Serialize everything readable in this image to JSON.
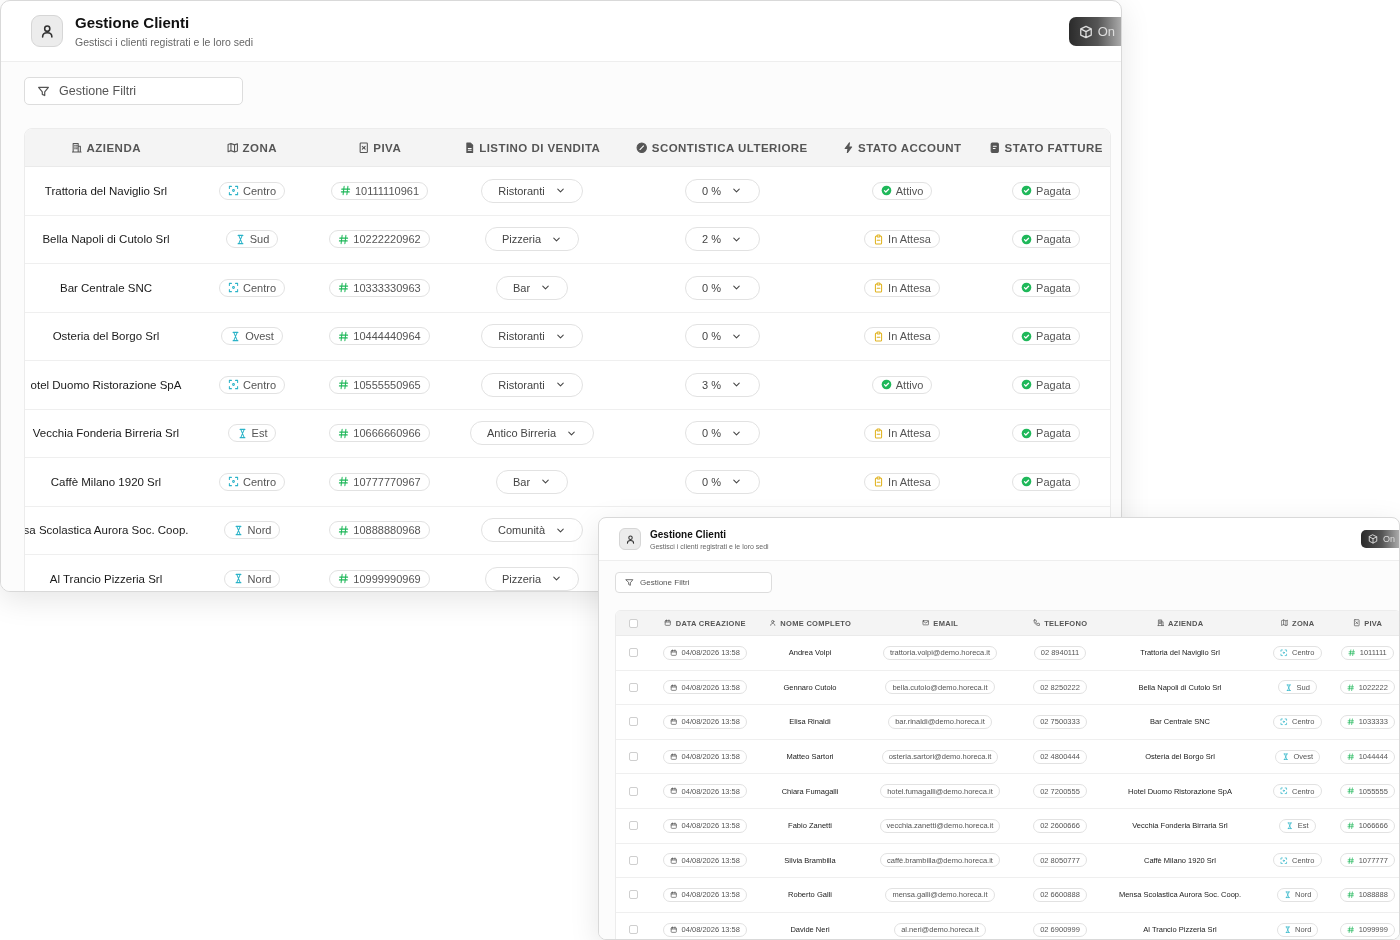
{
  "windows": [
    {
      "title": "Gestione Clienti",
      "subtitle": "Gestisci i clienti registrati e le loro sedi",
      "action_button": "On",
      "filter_button": "Gestione Filtri",
      "table": {
        "columns": [
          {
            "label": "AZIENDA",
            "kind": "company"
          },
          {
            "label": "ZONA",
            "kind": "zone"
          },
          {
            "label": "PIVA",
            "kind": "vat"
          },
          {
            "label": "LISTINO DI VENDITA",
            "kind": "price_list"
          },
          {
            "label": "SCONTISTICA ULTERIORE",
            "kind": "discount"
          },
          {
            "label": "STATO ACCOUNT",
            "kind": "account"
          },
          {
            "label": "STATO FATTURE",
            "kind": "invoice"
          }
        ],
        "rows": [
          {
            "cells": [
              "Trattoria del Naviglio Srl",
              {
                "label": "Centro",
                "kind": "center"
              },
              "10111110961",
              "Ristoranti",
              "0 %",
              {
                "label": "Attivo",
                "kind": "active"
              },
              {
                "label": "Pagata",
                "kind": "paid"
              }
            ]
          },
          {
            "cells": [
              "Bella Napoli di Cutolo Srl",
              {
                "label": "Sud",
                "kind": "direction"
              },
              "10222220962",
              "Pizzeria",
              "2 %",
              {
                "label": "In Attesa",
                "kind": "pending"
              },
              {
                "label": "Pagata",
                "kind": "paid"
              }
            ]
          },
          {
            "cells": [
              "Bar Centrale SNC",
              {
                "label": "Centro",
                "kind": "center"
              },
              "10333330963",
              "Bar",
              "0 %",
              {
                "label": "In Attesa",
                "kind": "pending"
              },
              {
                "label": "Pagata",
                "kind": "paid"
              }
            ]
          },
          {
            "cells": [
              "Osteria del Borgo Srl",
              {
                "label": "Ovest",
                "kind": "direction"
              },
              "10444440964",
              "Ristoranti",
              "0 %",
              {
                "label": "In Attesa",
                "kind": "pending"
              },
              {
                "label": "Pagata",
                "kind": "paid"
              }
            ]
          },
          {
            "cells": [
              "otel Duomo Ristorazione SpA",
              {
                "label": "Centro",
                "kind": "center"
              },
              "10555550965",
              "Ristoranti",
              "3 %",
              {
                "label": "Attivo",
                "kind": "active"
              },
              {
                "label": "Pagata",
                "kind": "paid"
              }
            ]
          },
          {
            "cells": [
              "Vecchia Fonderia Birreria Srl",
              {
                "label": "Est",
                "kind": "direction"
              },
              "10666660966",
              "Antico Birreria",
              "0 %",
              {
                "label": "In Attesa",
                "kind": "pending"
              },
              {
                "label": "Pagata",
                "kind": "paid"
              }
            ]
          },
          {
            "cells": [
              "Caffè Milano 1920 Srl",
              {
                "label": "Centro",
                "kind": "center"
              },
              "10777770967",
              "Bar",
              "0 %",
              {
                "label": "In Attesa",
                "kind": "pending"
              },
              {
                "label": "Pagata",
                "kind": "paid"
              }
            ]
          },
          {
            "cells": [
              "sa Scolastica Aurora Soc. Coop.",
              {
                "label": "Nord",
                "kind": "direction"
              },
              "10888880968",
              "Comunità",
              null,
              null,
              null
            ]
          },
          {
            "cells": [
              "Al Trancio Pizzeria Srl",
              {
                "label": "Nord",
                "kind": "direction"
              },
              "10999990969",
              "Pizzeria",
              null,
              null,
              null
            ]
          }
        ]
      }
    },
    {
      "title": "Gestione Clienti",
      "subtitle": "Gestisci i clienti registrati e le loro sedi",
      "action_button": "On",
      "filter_button": "Gestione Filtri",
      "table": {
        "header_checkbox": {
          "checked": false
        },
        "columns": [
          {
            "label": "DATA CREAZIONE",
            "kind": "date"
          },
          {
            "label": "NOME COMPLETO",
            "kind": "name"
          },
          {
            "label": "EMAIL",
            "kind": "email"
          },
          {
            "label": "TELEFONO",
            "kind": "phone"
          },
          {
            "label": "AZIENDA",
            "kind": "company"
          },
          {
            "label": "ZONA",
            "kind": "zone"
          },
          {
            "label": "PIVA",
            "kind": "vat"
          }
        ],
        "rows": [
          {
            "checked": false,
            "cells": [
              "04/08/2026 13:58",
              "Andrea Volpi",
              "trattoria.volpi@demo.horeca.it",
              "02 8940111",
              "Trattoria del Naviglio Srl",
              {
                "label": "Centro",
                "kind": "center"
              },
              "1011111"
            ]
          },
          {
            "checked": false,
            "cells": [
              "04/08/2026 13:58",
              "Gennaro Cutolo",
              "bella.cutolo@demo.horeca.it",
              "02 8250222",
              "Bella Napoli di Cutolo Srl",
              {
                "label": "Sud",
                "kind": "direction"
              },
              "1022222"
            ]
          },
          {
            "checked": false,
            "cells": [
              "04/08/2026 13:58",
              "Elisa Rinaldi",
              "bar.rinaldi@demo.horeca.it",
              "02 7500333",
              "Bar Centrale SNC",
              {
                "label": "Centro",
                "kind": "center"
              },
              "1033333"
            ]
          },
          {
            "checked": false,
            "cells": [
              "04/08/2026 13:58",
              "Matteo Sartori",
              "osteria.sartori@demo.horeca.it",
              "02 4800444",
              "Osteria del Borgo Srl",
              {
                "label": "Ovest",
                "kind": "direction"
              },
              "1044444"
            ]
          },
          {
            "checked": false,
            "cells": [
              "04/08/2026 13:58",
              "Chiara Fumagalli",
              "hotel.fumagalli@demo.horeca.it",
              "02 7200555",
              "Hotel Duomo Ristorazione SpA",
              {
                "label": "Centro",
                "kind": "center"
              },
              "1055555"
            ]
          },
          {
            "checked": false,
            "cells": [
              "04/08/2026 13:58",
              "Fabio Zanetti",
              "vecchia.zanetti@demo.horeca.it",
              "02 2600666",
              "Vecchia Fonderia Birraria Srl",
              {
                "label": "Est",
                "kind": "direction"
              },
              "1066666"
            ]
          },
          {
            "checked": false,
            "cells": [
              "04/08/2026 13:58",
              "Silvia Brambilla",
              "caffè.brambilla@demo.horeca.it",
              "02 8050777",
              "Caffè Milano 1920 Srl",
              {
                "label": "Centro",
                "kind": "center"
              },
              "1077777"
            ]
          },
          {
            "checked": false,
            "cells": [
              "04/08/2026 13:58",
              "Roberto Galli",
              "mensa.galli@demo.horeca.it",
              "02 6600888",
              "Mensa Scolastica Aurora Soc. Coop.",
              {
                "label": "Nord",
                "kind": "direction"
              },
              "1088888"
            ]
          },
          {
            "checked": false,
            "cells": [
              "04/08/2026 13:58",
              "Davide Neri",
              "al.neri@demo.horeca.it",
              "02 6900999",
              "Al Trancio Pizzeria Srl",
              {
                "label": "Nord",
                "kind": "direction"
              },
              "1099999"
            ]
          }
        ]
      }
    }
  ]
}
